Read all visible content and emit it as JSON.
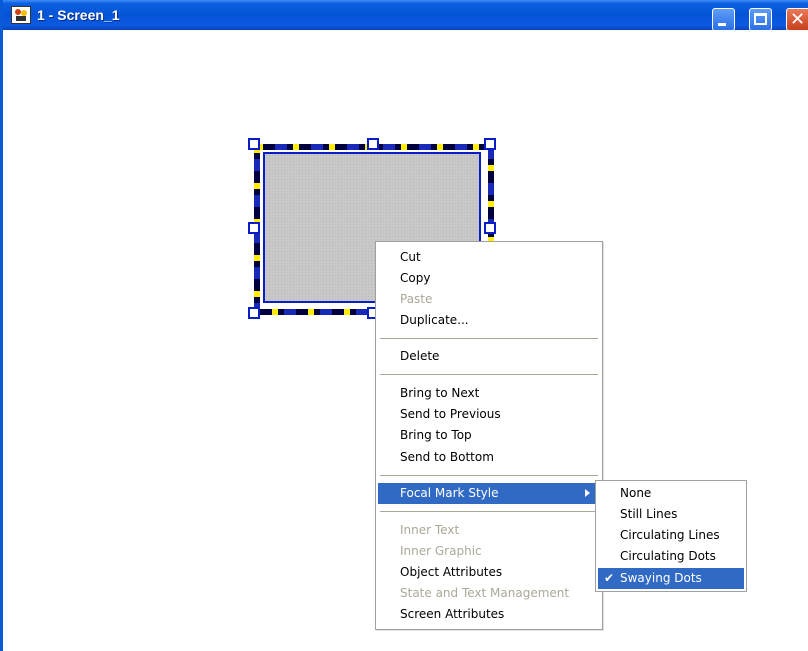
{
  "window": {
    "title": "1 - Screen_1",
    "icons": {
      "app": "app-icon",
      "minimize": "minimize-icon",
      "maximize": "maximize-icon",
      "close": "close-icon"
    }
  },
  "context_menu": {
    "items": [
      {
        "label": "Cut",
        "enabled": true
      },
      {
        "label": "Copy",
        "enabled": true
      },
      {
        "label": "Paste",
        "enabled": false
      },
      {
        "label": "Duplicate...",
        "enabled": true
      },
      {
        "label": "Delete",
        "enabled": true
      },
      {
        "label": "Bring to Next",
        "enabled": true
      },
      {
        "label": "Send to Previous",
        "enabled": true
      },
      {
        "label": "Bring to Top",
        "enabled": true
      },
      {
        "label": "Send to Bottom",
        "enabled": true
      },
      {
        "label": "Focal Mark Style",
        "enabled": true,
        "highlighted": true,
        "has_submenu": true
      },
      {
        "label": "Inner Text",
        "enabled": false
      },
      {
        "label": "Inner Graphic",
        "enabled": false
      },
      {
        "label": "Object Attributes",
        "enabled": true
      },
      {
        "label": "State and Text Management",
        "enabled": false
      },
      {
        "label": "Screen Attributes",
        "enabled": true
      }
    ]
  },
  "submenu": {
    "items": [
      {
        "label": "None"
      },
      {
        "label": "Still Lines"
      },
      {
        "label": "Circulating Lines"
      },
      {
        "label": "Circulating Dots"
      },
      {
        "label": "Swaying Dots",
        "checked": true,
        "highlighted": true
      }
    ]
  },
  "colors": {
    "titlebar": "#0654d8",
    "menu_highlight": "#316ac5",
    "disabled_text": "#aca899",
    "selection_dash_yellow": "#ffee00",
    "selection_dash_dark": "#000040",
    "handle_border": "#0a1ec8"
  }
}
